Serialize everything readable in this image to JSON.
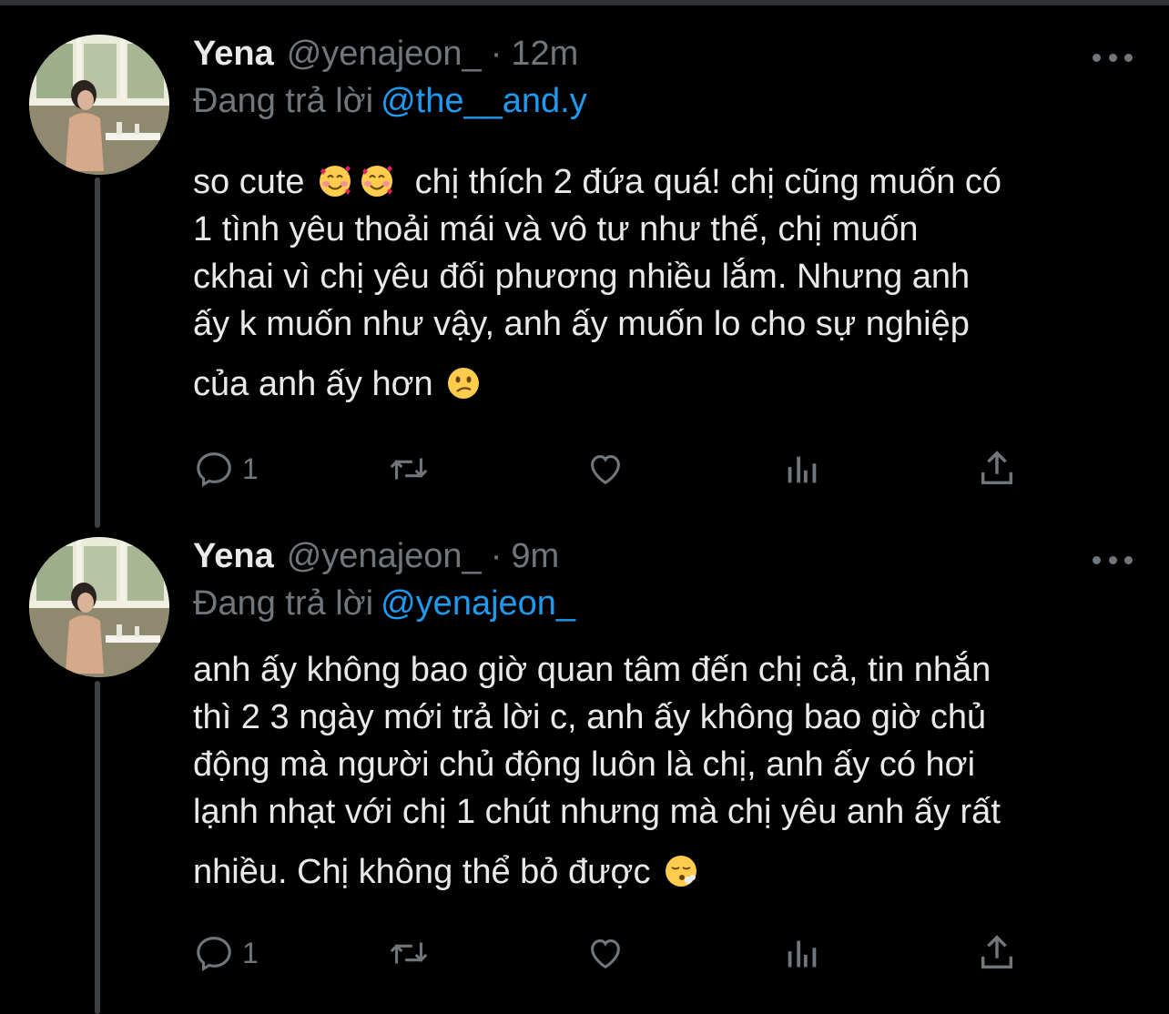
{
  "tweets": [
    {
      "name": "Yena",
      "handle": "@yenajeon_",
      "separator": "·",
      "time": "12m",
      "reply_prefix": "Đang trả lời",
      "reply_to": "@the__and.y",
      "lines": [
        "so cute",
        "chị thích 2 đứa quá! chị cũng muốn có",
        "1 tình yêu thoải mái và vô tư như thế, chị muốn",
        "ckhai vì chị yêu đối phương nhiều lắm. Nhưng anh",
        "ấy k muốn như vậy, anh ấy muốn lo cho sự nghiệp",
        "của anh ấy hơn"
      ],
      "emojis": [
        "smiling-face-with-hearts",
        "smiling-face-with-hearts",
        "confused-face"
      ],
      "reply_count": "1",
      "icons": [
        "reply-icon",
        "retweet-icon",
        "like-icon",
        "analytics-icon",
        "share-icon"
      ]
    },
    {
      "name": "Yena",
      "handle": "@yenajeon_",
      "separator": "·",
      "time": "9m",
      "reply_prefix": "Đang trả lời",
      "reply_to": "@yenajeon_",
      "lines": [
        "anh ấy không bao giờ quan tâm đến chị cả, tin nhắn",
        "thì 2 3 ngày mới trả lời c, anh ấy không bao giờ chủ",
        "động mà người chủ động luôn là chị, anh ấy có hơi",
        "lạnh nhạt với chị 1 chút nhưng mà chị yêu anh ấy rất",
        "nhiều. Chị không thể bỏ được"
      ],
      "emojis": [
        "face-exhaling"
      ],
      "reply_count": "1",
      "icons": [
        "reply-icon",
        "retweet-icon",
        "like-icon",
        "analytics-icon",
        "share-icon"
      ]
    }
  ],
  "colors": {
    "background": "#000000",
    "text": "#e7e9ea",
    "secondary": "#71767b",
    "link": "#1d9bf0",
    "thread_line": "#3e4144"
  }
}
